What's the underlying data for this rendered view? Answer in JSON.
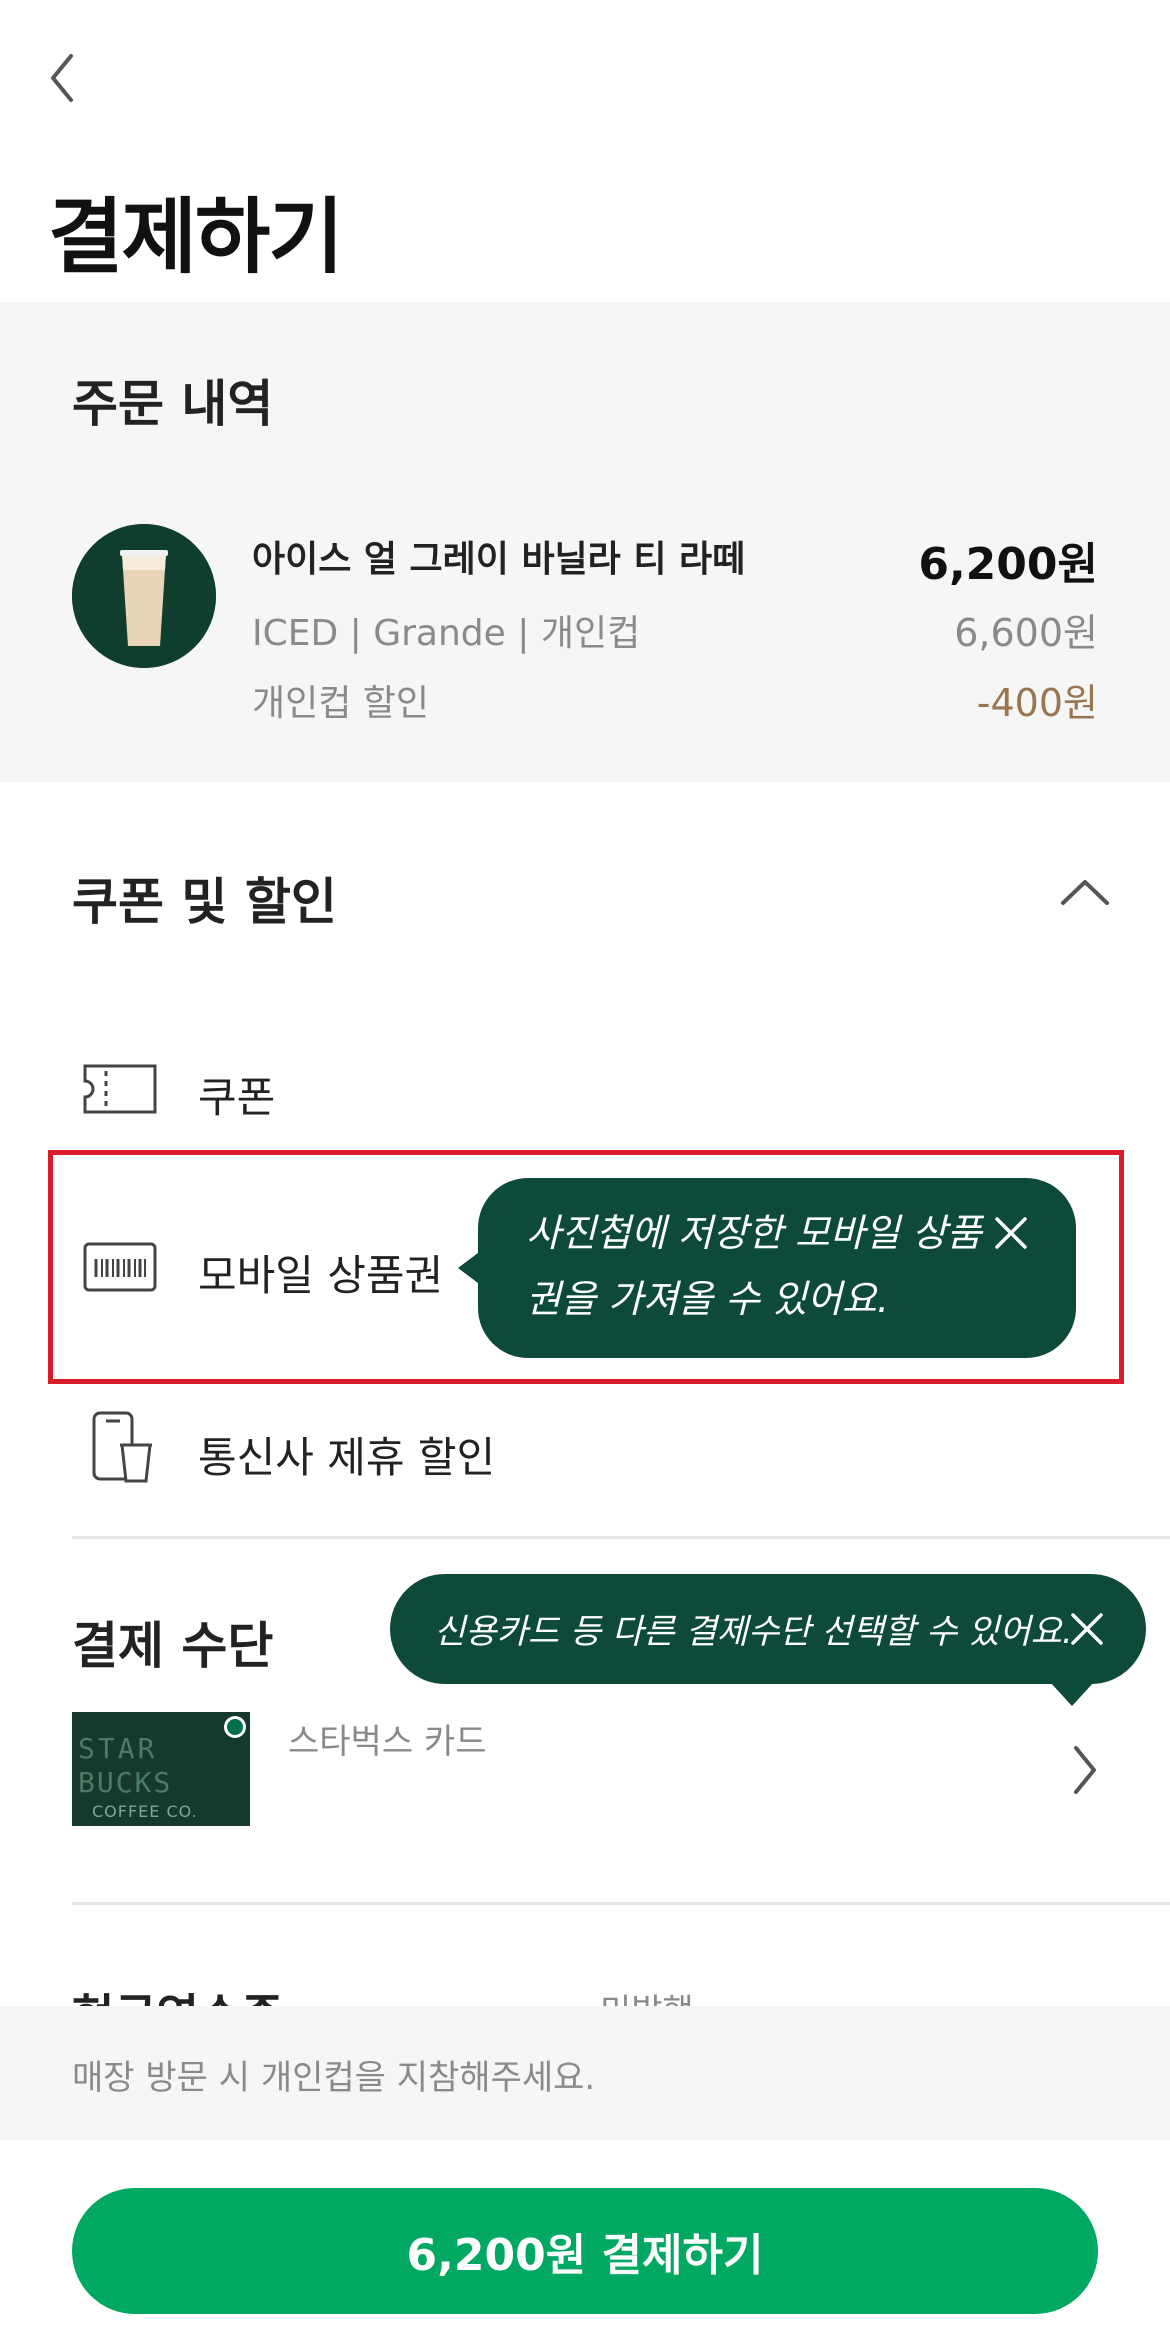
{
  "header": {
    "title": "결제하기"
  },
  "order": {
    "heading": "주문 내역",
    "item": {
      "name": "아이스 얼 그레이 바닐라 티 라떼",
      "options": "ICED | Grande | 개인컵",
      "discount_label": "개인컵 할인",
      "final_price": "6,200원",
      "original_price": "6,600원",
      "discount_amount": "-400원"
    }
  },
  "coupons": {
    "heading": "쿠폰 및 할인",
    "items": [
      {
        "label": "쿠폰",
        "icon": "ticket-icon"
      },
      {
        "label": "모바일 상품권",
        "icon": "gift-card-icon"
      },
      {
        "label": "통신사 제휴 할인",
        "icon": "phone-cup-icon"
      }
    ],
    "tooltip": "사진첩에 저장한 모바일 상품권을 가져올 수 있어요."
  },
  "payment": {
    "heading": "결제 수단",
    "tooltip": "신용카드 등 다른 결제수단 선택할 수 있어요.",
    "card": {
      "name": "스타벅스 카드",
      "art_text_1": "STAR",
      "art_text_2": "BUCKS",
      "art_text_3": "COFFEE CO."
    }
  },
  "cutoff_row": {
    "left": "현금영수증",
    "right": "미발행"
  },
  "notice": "매장 방문 시 개인컵을 지참해주세요.",
  "pay_button": "6,200원 결제하기",
  "colors": {
    "brand_green": "#00a862",
    "tooltip_green": "#0e4a3a",
    "highlight_red": "#d91d2a",
    "discount_brown": "#9a7650"
  }
}
